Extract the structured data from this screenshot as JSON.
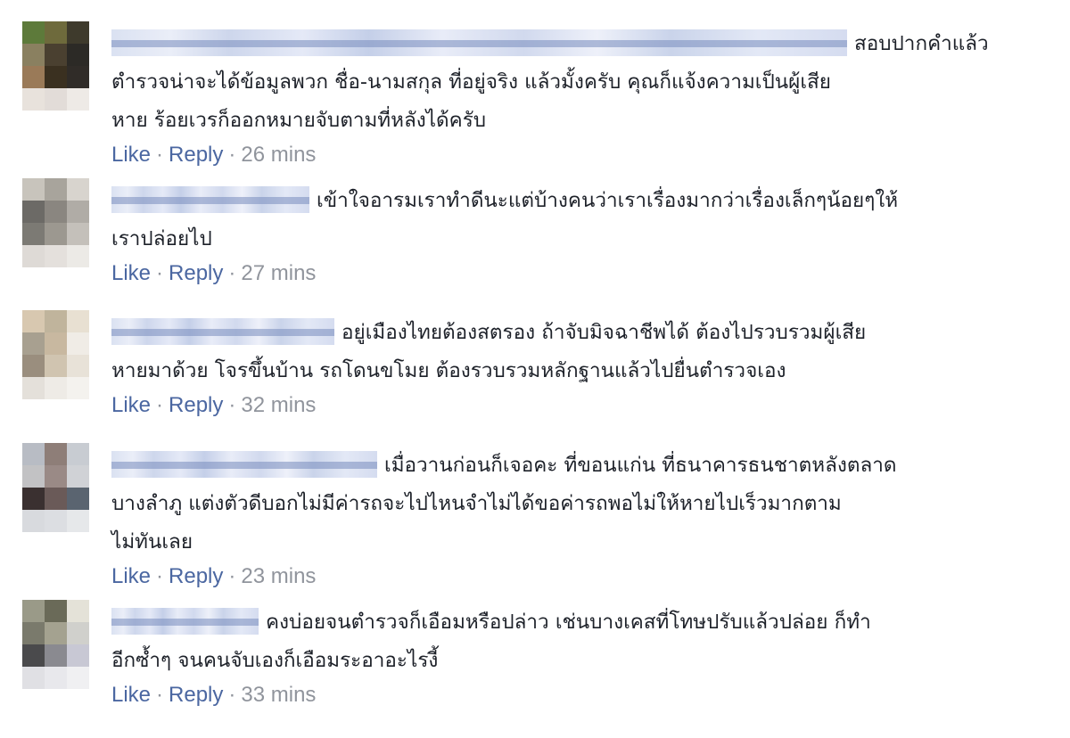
{
  "comments": [
    {
      "text": "สอบปากคำแล้ว\nตำรวจน่าจะได้ข้อมูลพวก ชื่อ-นามสกุล ที่อยู่จริง แล้วมั้งครับ คุณก็แจ้งความเป็นผู้เสีย\nหาย ร้อยเวรก็ออกหมายจับตามที่หลังได้ครับ",
      "like": "Like",
      "reply": "Reply",
      "time": "26 mins",
      "avatar": [
        "#5d7a3a",
        "#6e6a3c",
        "#3e3a2c",
        "#8a8060",
        "#4a4030",
        "#2c2a26",
        "#9a7a58",
        "#3a3020",
        "#302c28",
        "#e8e2dc",
        "#e2dcd8",
        "#eeeae6"
      ]
    },
    {
      "text": "เข้าใจอารมเราทำดีนะแต่บ้างคนว่าเราเรื่องมากว่าเรื่องเล็กๆน้อยๆให้\nเราปล่อยไป",
      "like": "Like",
      "reply": "Reply",
      "time": "27 mins",
      "avatar": [
        "#c8c4bc",
        "#a8a49c",
        "#d8d4ce",
        "#6c6a66",
        "#8a8680",
        "#b0aca6",
        "#7c7a74",
        "#9c9890",
        "#c4c0ba",
        "#dedad6",
        "#e4e0dc",
        "#eceae6"
      ]
    },
    {
      "text": "อยู่เมืองไทยต้องสตรอง ถ้าจับมิจฉาชีพได้ ต้องไปรวบรวมผู้เสีย\nหายมาด้วย โจรขึ้นบ้าน รถโดนขโมย ต้องรวบรวมหลักฐานแล้วไปยื่นตำรวจเอง",
      "like": "Like",
      "reply": "Reply",
      "time": "32 mins",
      "avatar": [
        "#d8c8b0",
        "#c0b49c",
        "#e8e0d2",
        "#a8a090",
        "#c8b8a0",
        "#f0ece6",
        "#9a8e7e",
        "#d0c4b0",
        "#e8e2d8",
        "#e4e0da",
        "#eeebe6",
        "#f4f2ee"
      ]
    },
    {
      "text": "เมื่อวานก่อนก็เจอคะ ที่ขอนแก่น ที่ธนาคารธนชาตหลังตลาด\nบางลำภู แต่งตัวดีบอกไม่มีค่ารถจะไปไหนจำไม่ได้ขอค่ารถพอไม่ให้หายไปเร็วมากตาม\nไม่ทันเลย",
      "like": "Like",
      "reply": "Reply",
      "time": "23 mins",
      "avatar": [
        "#b8bcc4",
        "#8e7e78",
        "#c8ccd2",
        "#c2c2c4",
        "#9a8a86",
        "#d0d2d6",
        "#3a3030",
        "#6a5a58",
        "#5a6470",
        "#d8dade",
        "#dcdee2",
        "#e6e8ea"
      ]
    },
    {
      "text": "คงบ่อยจนตำรวจก็เอือมหรือปล่าว เช่นบางเคสที่โทษปรับแล้วปล่อย ก็ทำ\nอีกซ้ำๆ จนคนจับเองก็เอือมระอาอะไรงี้",
      "like": "Like",
      "reply": "Reply",
      "time": "33 mins",
      "avatar": [
        "#9a9a88",
        "#6a6a58",
        "#e4e2d8",
        "#7a7a6c",
        "#a4a290",
        "#d0d0cc",
        "#4a4a4c",
        "#8a8a90",
        "#c8c8d4",
        "#e0e0e4",
        "#e8e8ec",
        "#f0f0f2"
      ]
    }
  ]
}
